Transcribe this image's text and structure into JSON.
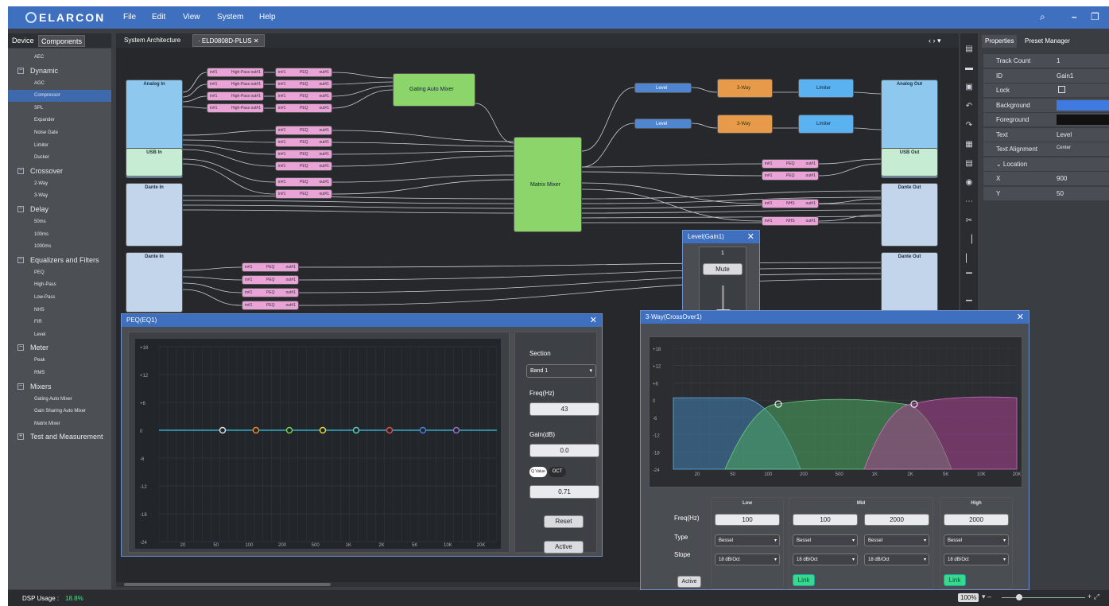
{
  "app": {
    "logo": "ELARCON",
    "menu": [
      "File",
      "Edit",
      "View",
      "System",
      "Help"
    ]
  },
  "left_tabs": [
    "Device",
    "Components"
  ],
  "components": [
    {
      "type": "item",
      "label": "AEC"
    },
    {
      "type": "cat",
      "label": "Dynamic",
      "sign": "−"
    },
    {
      "type": "item",
      "label": "AGC"
    },
    {
      "type": "item",
      "label": "Compressor",
      "selected": true
    },
    {
      "type": "item",
      "label": "SPL"
    },
    {
      "type": "item",
      "label": "Expander"
    },
    {
      "type": "item",
      "label": "Noise Gate"
    },
    {
      "type": "item",
      "label": "Limiter"
    },
    {
      "type": "item",
      "label": "Ducker"
    },
    {
      "type": "cat",
      "label": "Crossover",
      "sign": "−"
    },
    {
      "type": "item",
      "label": "2-Way"
    },
    {
      "type": "item",
      "label": "3-Way"
    },
    {
      "type": "cat",
      "label": "Delay",
      "sign": "−"
    },
    {
      "type": "item",
      "label": "50ms"
    },
    {
      "type": "item",
      "label": "100ms"
    },
    {
      "type": "item",
      "label": "1000ms"
    },
    {
      "type": "cat",
      "label": "Equalizers and Filters",
      "sign": "−"
    },
    {
      "type": "item",
      "label": "PEQ"
    },
    {
      "type": "item",
      "label": "High-Pass"
    },
    {
      "type": "item",
      "label": "Low-Pass"
    },
    {
      "type": "item",
      "label": "NHS"
    },
    {
      "type": "item",
      "label": "FIR"
    },
    {
      "type": "item",
      "label": "Level"
    },
    {
      "type": "cat",
      "label": "Meter",
      "sign": "−"
    },
    {
      "type": "item",
      "label": "Peak"
    },
    {
      "type": "item",
      "label": "RMS"
    },
    {
      "type": "cat",
      "label": "Mixers",
      "sign": "−"
    },
    {
      "type": "item",
      "label": "Gating Auto Mixer"
    },
    {
      "type": "item",
      "label": "Gain Sharing Auto Mixer"
    },
    {
      "type": "item",
      "label": "Matrix Mixer"
    },
    {
      "type": "cat",
      "label": "Test and Measurement",
      "sign": "+"
    }
  ],
  "doc_tabs": [
    "System Architecture",
    "· ELD0808D-PLUS"
  ],
  "blocks": {
    "analog_in": "Analog In",
    "usb_in": "USB In",
    "dante_in": "Dante In",
    "dante_in2": "Dante In",
    "analog_out": "Analog Out",
    "usb_out": "USB Out",
    "dante_out": "Dante Out",
    "dante_out2": "Dante Out",
    "gating": "Gating Auto Mixer",
    "matrix": "Matrix Mixer",
    "high_pass": "High-Pass",
    "peq": "PEQ",
    "nhs": "NHS",
    "level": "Level",
    "threeway": "3-Way",
    "limiter": "Limiter",
    "in1": "in#1",
    "out1": "out#1"
  },
  "props_tabs": [
    "Properties",
    "Preset Manager"
  ],
  "properties": [
    {
      "k": "Track Count",
      "v": "1"
    },
    {
      "k": "ID",
      "v": "Gain1"
    },
    {
      "k": "Lock",
      "v": ""
    },
    {
      "k": "Background",
      "v": ""
    },
    {
      "k": "Foreground",
      "v": ""
    },
    {
      "k": "Text",
      "v": "Level"
    },
    {
      "k": "Text Alignment",
      "v": "Center"
    },
    {
      "k": "⌄ Location",
      "v": ""
    },
    {
      "k": "X",
      "v": "900"
    },
    {
      "k": "Y",
      "v": "50"
    }
  ],
  "level_win": {
    "title": "Level(Gain1)",
    "channel": "1",
    "mute": "Mute"
  },
  "peq": {
    "title": "PEQ(EQ1)",
    "section_label": "Section",
    "band": "Band 1",
    "freq_label": "Freq(Hz)",
    "freq": "43",
    "gain_label": "Gain(dB)",
    "gain": "0.0",
    "q_label": "Q Value",
    "oct_label": "OCT",
    "q": "0.71",
    "reset": "Reset",
    "active": "Active",
    "ylabels": [
      "+18",
      "+12",
      "+6",
      "0",
      "-6",
      "-12",
      "-18",
      "-24"
    ],
    "xlabels": [
      "20",
      "50",
      "100",
      "200",
      "500",
      "1K",
      "2K",
      "5K",
      "10K",
      "20K"
    ],
    "point_colors": [
      "#e0e0e0",
      "#f08c2c",
      "#7ad34a",
      "#e8d83a",
      "#5fd0c0",
      "#e05050",
      "#4a7fe0",
      "#a070d0"
    ]
  },
  "xover": {
    "title": "3-Way(CrossOver1)",
    "freq_label": "Freq(Hz)",
    "type_label": "Type",
    "slope_label": "Slope",
    "active": "Active",
    "low": {
      "title": "Low",
      "freq": "100",
      "type": "Bessel",
      "slope": "18 dB/Oct"
    },
    "mid": {
      "title": "Mid",
      "freq_lo": "100",
      "freq_hi": "2000",
      "type_lo": "Bessel",
      "type_hi": "Bessel",
      "slope_lo": "18 dB/Oct",
      "slope_hi": "18 dB/Oct",
      "link": "Link"
    },
    "high": {
      "title": "High",
      "freq": "2000",
      "type": "Bessel",
      "slope": "18 dB/Oct",
      "link": "Link"
    },
    "ylabels": [
      "+18",
      "+12",
      "+6",
      "0",
      "-6",
      "-12",
      "-18",
      "-24"
    ],
    "xlabels": [
      "20",
      "50",
      "100",
      "200",
      "500",
      "1K",
      "2K",
      "5K",
      "10K",
      "20K"
    ]
  },
  "status": {
    "dsp_label": "DSP Usage :",
    "dsp_value": "18.8%",
    "zoom": "100%"
  },
  "colors": {
    "accent": "#3f6fbf",
    "ok": "#4de08a"
  }
}
